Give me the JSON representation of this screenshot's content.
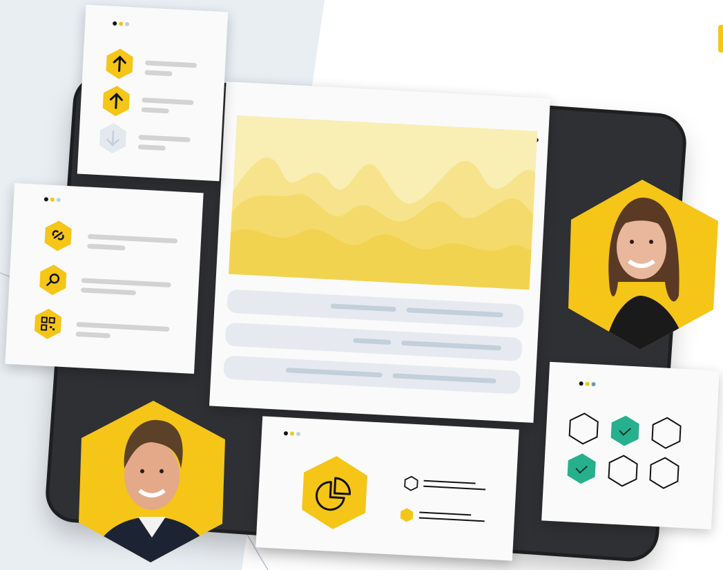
{
  "colors": {
    "accent": "#f5c518",
    "dark": "#2f3033",
    "teal": "#27b08d",
    "light_blue": "#c3cfdb",
    "panel_bg": "#fafafa"
  },
  "icons": {
    "upload_1": "arrow-up-icon",
    "upload_2": "arrow-up-icon",
    "download": "arrow-down-icon",
    "link": "link-icon",
    "search": "magnifier-icon",
    "qr": "qr-code-icon",
    "chart": "pie-chart-icon"
  },
  "checks_grid": [
    false,
    true,
    false,
    true,
    false,
    false
  ],
  "people": [
    "man-portrait",
    "woman-portrait"
  ]
}
